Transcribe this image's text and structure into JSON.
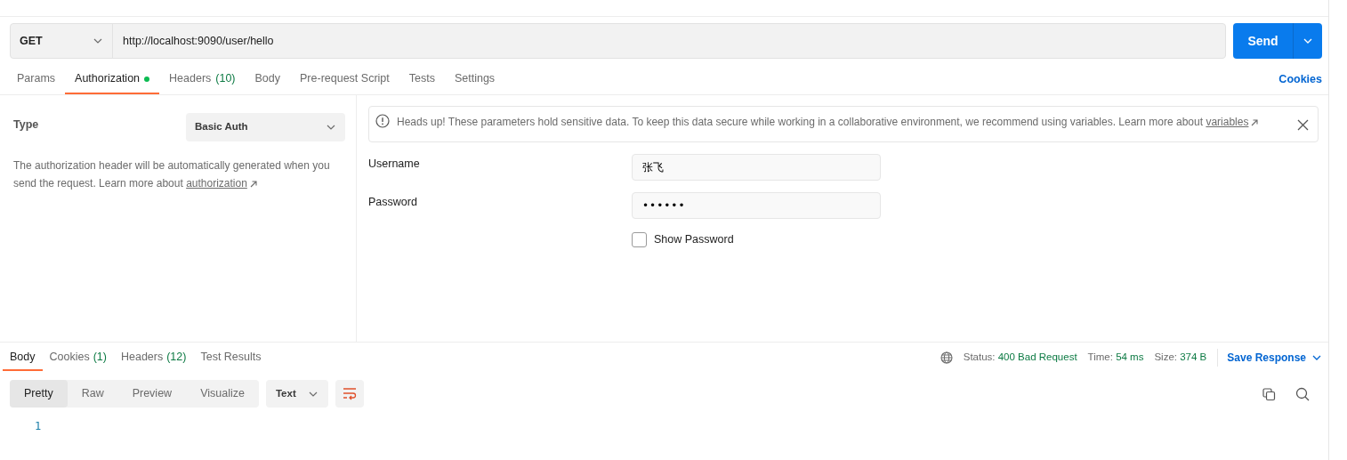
{
  "request": {
    "method": "GET",
    "url": "http://localhost:9090/user/hello",
    "send": "Send"
  },
  "request_tabs": [
    {
      "label": "Params",
      "selected": false
    },
    {
      "label": "Authorization",
      "selected": true,
      "color": "#0cbb52"
    },
    {
      "label": "Headers",
      "count": "(10)",
      "selected": false
    },
    {
      "label": "Body",
      "selected": false
    },
    {
      "label": "Pre-request Script",
      "selected": false
    },
    {
      "label": "Tests",
      "selected": false
    },
    {
      "label": "Settings",
      "selected": false
    }
  ],
  "cookies_link": "Cookies",
  "auth": {
    "type_label": "Type",
    "type_value": "Basic Auth",
    "description": "The authorization header will be automatically generated when you send the request. Learn more about",
    "description_link": "authorization",
    "alert": "Heads up! These parameters hold sensitive data. To keep this data secure while working in a collaborative environment, we recommend using variables. Learn more about",
    "alert_link": "variables",
    "fields": [
      {
        "label": "Username",
        "value": "张飞",
        "kind": "text"
      },
      {
        "label": "Password",
        "value": "••••••",
        "kind": "password"
      }
    ],
    "show_password": {
      "label": "Show Password",
      "checked": false
    }
  },
  "response_tabs": [
    {
      "label": "Body",
      "selected": true
    },
    {
      "label": "Cookies",
      "count": "(1)",
      "selected": false
    },
    {
      "label": "Headers",
      "count": "(12)",
      "selected": false
    },
    {
      "label": "Test Results",
      "selected": false
    }
  ],
  "response_meta": [
    {
      "label": "Status:",
      "value": "400 Bad Request"
    },
    {
      "label": "Time:",
      "value": "54 ms"
    },
    {
      "label": "Size:",
      "value": "374 B"
    }
  ],
  "save_response": "Save Response",
  "view_modes": [
    {
      "label": "Pretty",
      "selected": true
    },
    {
      "label": "Raw",
      "selected": false
    },
    {
      "label": "Preview",
      "selected": false
    },
    {
      "label": "Visualize",
      "selected": false
    }
  ],
  "format": "Text",
  "line_numbers": [
    "1"
  ]
}
